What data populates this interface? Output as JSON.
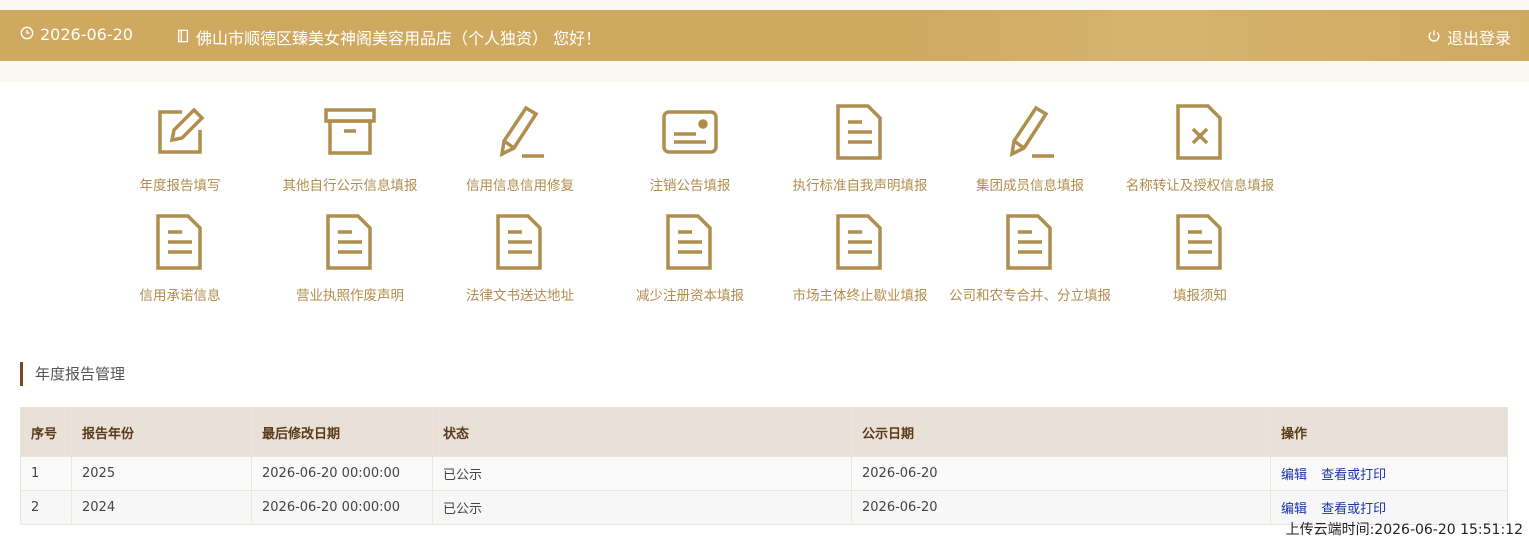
{
  "header": {
    "date": "2026-06-20",
    "greeting": "佛山市顺德区臻美女神阁美容用品店（个人独资） 您好！",
    "logout": "退出登录"
  },
  "menu": [
    {
      "label": "年度报告填写",
      "icon": "edit-icon"
    },
    {
      "label": "其他自行公示信息填报",
      "icon": "archive-box-icon"
    },
    {
      "label": "信用信息信用修复",
      "icon": "pencil-icon"
    },
    {
      "label": "注销公告填报",
      "icon": "id-card-icon"
    },
    {
      "label": "执行标准自我声明填报",
      "icon": "document-icon"
    },
    {
      "label": "集团成员信息填报",
      "icon": "pencil-icon"
    },
    {
      "label": "名称转让及授权信息填报",
      "icon": "document-x-icon"
    },
    {
      "label": "信用承诺信息",
      "icon": "document-icon"
    },
    {
      "label": "营业执照作废声明",
      "icon": "document-icon"
    },
    {
      "label": "法律文书送达地址",
      "icon": "document-icon"
    },
    {
      "label": "减少注册资本填报",
      "icon": "document-icon"
    },
    {
      "label": "市场主体终止歇业填报",
      "icon": "document-icon"
    },
    {
      "label": "公司和农专合并、分立填报",
      "icon": "document-icon"
    },
    {
      "label": "填报须知",
      "icon": "document-icon"
    }
  ],
  "section": {
    "title": "年度报告管理"
  },
  "table": {
    "headers": [
      "序号",
      "报告年份",
      "最后修改日期",
      "状态",
      "公示日期",
      "操作"
    ],
    "rows": [
      {
        "no": "1",
        "year": "2025",
        "modified": "2026-06-20 00:00:00",
        "status": "已公示",
        "pubdate": "2026-06-20",
        "edit": "编辑",
        "view": "查看或打印"
      },
      {
        "no": "2",
        "year": "2024",
        "modified": "2026-06-20 00:00:00",
        "status": "已公示",
        "pubdate": "2026-06-20",
        "edit": "编辑",
        "view": "查看或打印"
      }
    ]
  },
  "upload_time": "上传云端时间:2026-06-20 15:51:12",
  "colors": {
    "header": "#d0a961",
    "icon": "#b08e4e",
    "link": "#1a35a8"
  }
}
